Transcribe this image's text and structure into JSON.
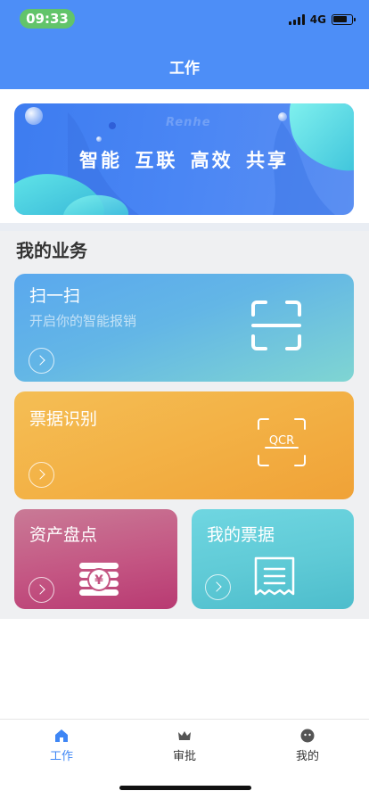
{
  "status_bar": {
    "time": "09:33",
    "network": "4G"
  },
  "header": {
    "title": "工作"
  },
  "banner": {
    "watermark": "Renhe",
    "slogan": "智能 互联 高效 共享"
  },
  "section": {
    "title": "我的业务"
  },
  "cards": [
    {
      "title": "扫一扫",
      "subtitle": "开启你的智能报销",
      "icon": "scan-frame-icon"
    },
    {
      "title": "票据识别",
      "icon_text": "QCR",
      "icon": "ocr-icon"
    },
    {
      "title": "资产盘点",
      "icon_text": "¥",
      "icon": "coin-stack-icon"
    },
    {
      "title": "我的票据",
      "icon": "receipt-icon"
    }
  ],
  "tabbar": {
    "items": [
      {
        "label": "工作",
        "icon": "home-icon",
        "active": true
      },
      {
        "label": "审批",
        "icon": "crown-icon",
        "active": false
      },
      {
        "label": "我的",
        "icon": "profile-icon",
        "active": false
      }
    ]
  },
  "colors": {
    "header": "#4d8ef7",
    "accent": "#3e86f5",
    "status_pill": "#62c46a",
    "card_scan": "#5aa8ee",
    "card_ocr": "#f3b145",
    "card_asset": "#c45683",
    "card_tickets": "#5fcad6"
  }
}
